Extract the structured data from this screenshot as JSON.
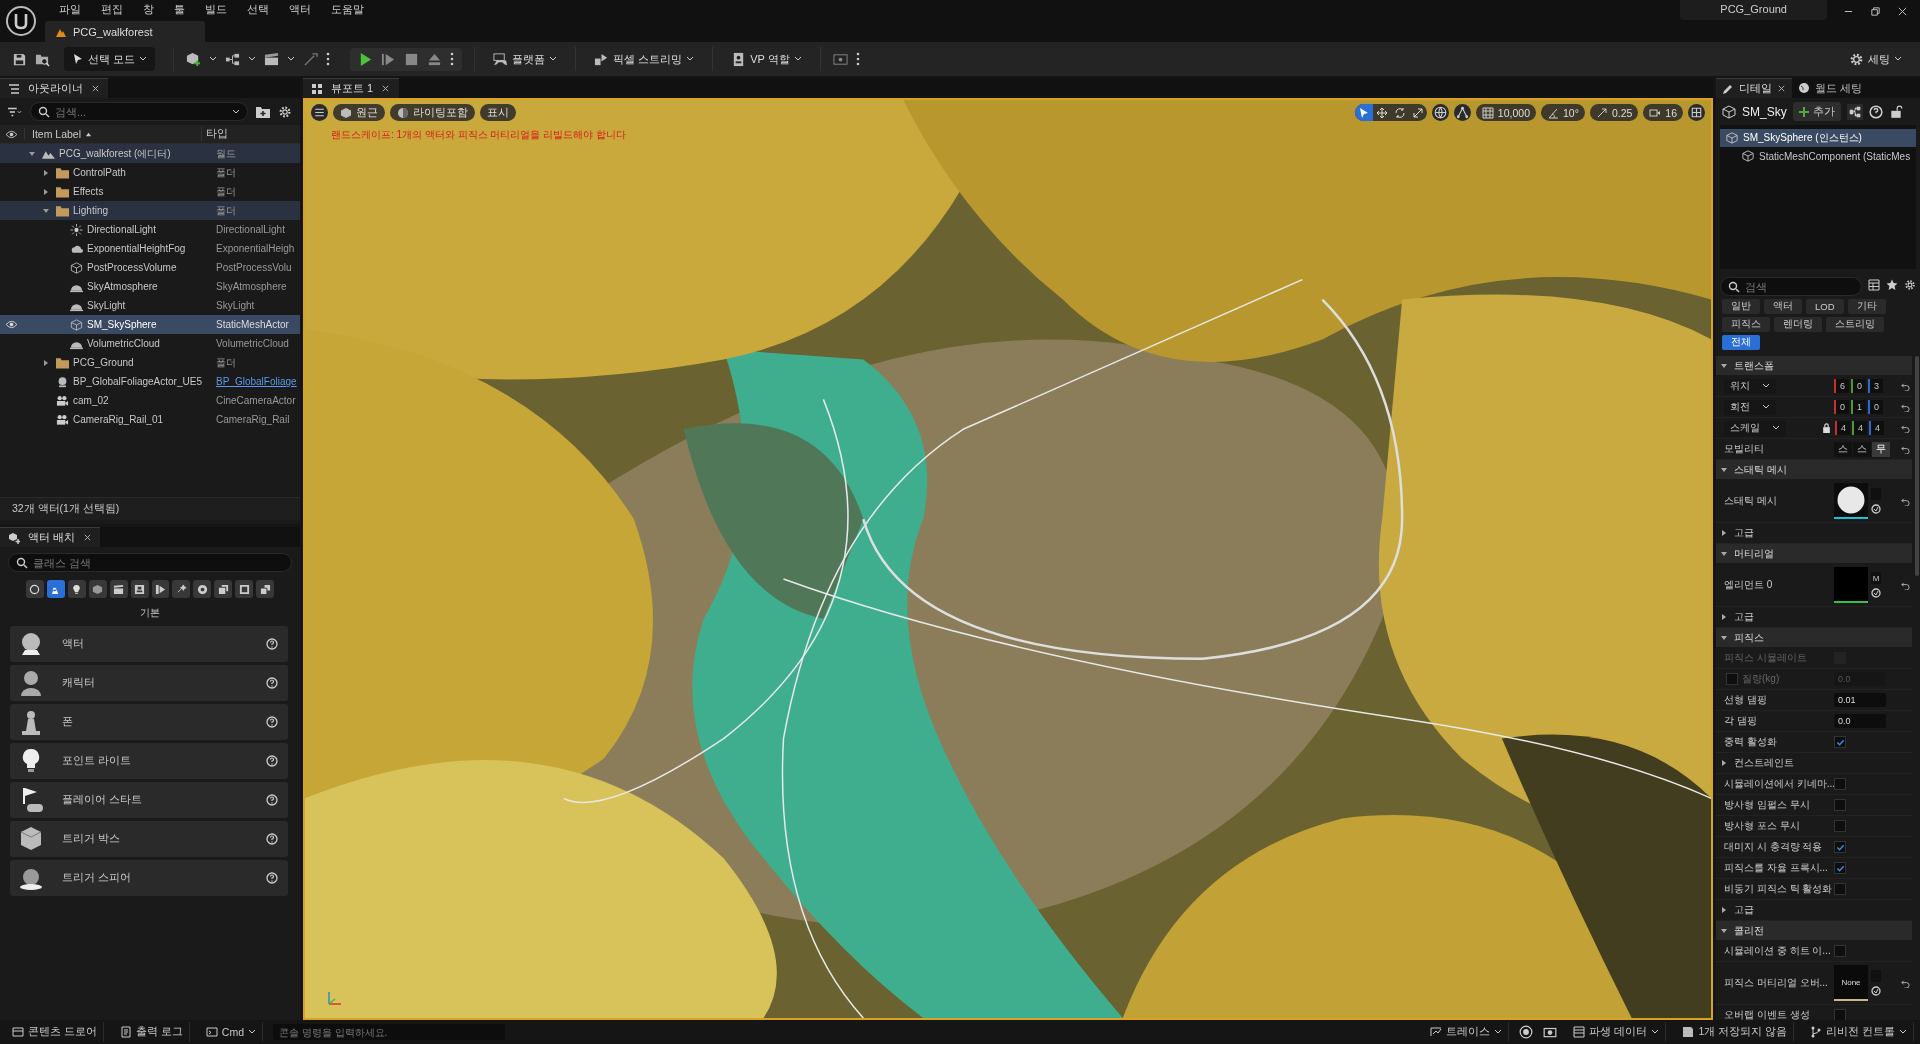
{
  "menu": [
    "파일",
    "편집",
    "창",
    "툴",
    "빌드",
    "선택",
    "액터",
    "도움말"
  ],
  "level_tab": "PCG_walkforest",
  "project": "PCG_Ground",
  "toolbar": {
    "mode": "선택 모드",
    "platform": "플랫폼",
    "pixel_streaming": "픽셀 스트리밍",
    "vp_role": "VP 역할",
    "settings": "세팅"
  },
  "outliner": {
    "tab": "아웃라이너",
    "search_placeholder": "검색...",
    "columns": [
      "Item Label",
      "타입"
    ],
    "tree": [
      {
        "label": "PCG_walkforest (에디터)",
        "type": "월드",
        "kind": "world",
        "selected": false,
        "linked": false,
        "expanded": true,
        "children": [
          {
            "label": "ControlPath",
            "type": "폴더",
            "kind": "folder",
            "selected": false,
            "linked": false,
            "expanded": false
          },
          {
            "label": "Effects",
            "type": "폴더",
            "kind": "folder",
            "selected": false,
            "linked": false,
            "expanded": false
          },
          {
            "label": "Lighting",
            "type": "폴더",
            "kind": "folder",
            "selected": false,
            "linked": false,
            "expanded": true,
            "children": [
              {
                "label": "DirectionalLight",
                "type": "DirectionalLight",
                "kind": "sun",
                "selected": false,
                "linked": false
              },
              {
                "label": "ExponentialHeightFog",
                "type": "ExponentialHeigh",
                "kind": "fog",
                "selected": false,
                "linked": false
              },
              {
                "label": "PostProcessVolume",
                "type": "PostProcessVolu",
                "kind": "volume",
                "selected": false,
                "linked": false
              },
              {
                "label": "SkyAtmosphere",
                "type": "SkyAtmosphere",
                "kind": "dome",
                "selected": false,
                "linked": false
              },
              {
                "label": "SkyLight",
                "type": "SkyLight",
                "kind": "dome",
                "selected": false,
                "linked": false
              },
              {
                "label": "SM_SkySphere",
                "type": "StaticMeshActor",
                "kind": "mesh",
                "selected": true,
                "linked": false
              },
              {
                "label": "VolumetricCloud",
                "type": "VolumetricCloud",
                "kind": "dome",
                "selected": false,
                "linked": false
              }
            ]
          },
          {
            "label": "PCG_Ground",
            "type": "폴더",
            "kind": "folder",
            "selected": false,
            "linked": false,
            "expanded": false
          },
          {
            "label": "BP_GlobalFoliageActor_UE5",
            "type": "BP_GlobalFoliage",
            "kind": "actor",
            "selected": false,
            "linked": true
          },
          {
            "label": "cam_02",
            "type": "CineCameraActor",
            "kind": "camera",
            "selected": false,
            "linked": false
          },
          {
            "label": "CameraRig_Rail_01",
            "type": "CameraRig_Rail",
            "kind": "rail",
            "selected": false,
            "linked": false
          }
        ]
      }
    ],
    "status": "32개 액터(1개 선택됨)"
  },
  "place_actors": {
    "tab": "액터 배치",
    "search_placeholder": "클래스 검색",
    "categories": [
      {
        "kind": "recent",
        "selected": false
      },
      {
        "kind": "basic",
        "selected": true
      },
      {
        "kind": "light",
        "selected": false
      },
      {
        "kind": "shape",
        "selected": false
      },
      {
        "kind": "cinematic",
        "selected": false
      },
      {
        "kind": "visual",
        "selected": false
      },
      {
        "kind": "volume",
        "selected": false
      },
      {
        "kind": "effects",
        "selected": false
      },
      {
        "kind": "classes",
        "selected": false
      },
      {
        "kind": "geometry",
        "selected": false
      },
      {
        "kind": "layout",
        "selected": false
      },
      {
        "kind": "extra",
        "selected": false
      }
    ],
    "heading": "기본",
    "items": [
      {
        "label": "액터",
        "kind": "actor"
      },
      {
        "label": "캐릭터",
        "kind": "character"
      },
      {
        "label": "폰",
        "kind": "pawn"
      },
      {
        "label": "포인트 라이트",
        "kind": "light"
      },
      {
        "label": "플레이어 스타트",
        "kind": "start"
      },
      {
        "label": "트리거 박스",
        "kind": "box"
      },
      {
        "label": "트리거 스피어",
        "kind": "sphere"
      }
    ]
  },
  "viewport": {
    "tab": "뷰포트 1",
    "view_buttons": [
      "원근",
      "라이팅포함",
      "표시"
    ],
    "warning": "랜드스케이프: 1개의 액터와 피직스 머티리얼을 리빌드해야 합니다",
    "tools": [
      {
        "kind": "select",
        "selected": true
      },
      {
        "kind": "move",
        "selected": false
      },
      {
        "kind": "rotate",
        "selected": false
      },
      {
        "kind": "scale",
        "selected": false
      }
    ],
    "grid_snap": "10,000",
    "rotation_snap": "10°",
    "scale_snap": "0.25",
    "camera_speed": "16"
  },
  "details": {
    "tabs": [
      {
        "label": "디테일",
        "selected": true
      },
      {
        "label": "월드 세팅",
        "selected": false
      }
    ],
    "actor_name": "SM_Sky",
    "add_button": "추가",
    "components": [
      {
        "label": "SM_SkySphere (인스턴스)",
        "selected": true
      },
      {
        "label": "StaticMeshComponent (StaticMes",
        "selected": false
      }
    ],
    "search_placeholder": "검색",
    "filters": [
      {
        "label": "일반",
        "selected": false
      },
      {
        "label": "액터",
        "selected": false
      },
      {
        "label": "LOD",
        "selected": false
      },
      {
        "label": "기타",
        "selected": false
      },
      {
        "label": "피직스",
        "selected": false
      },
      {
        "label": "렌더링",
        "selected": false
      },
      {
        "label": "스트리밍",
        "selected": false
      },
      {
        "label": "전체",
        "selected": true
      }
    ],
    "sections": [
      {
        "title": "트랜스폼",
        "expanded": true,
        "rows": [
          {
            "kind": "vector",
            "label": "위치",
            "values": [
              "6",
              "0",
              "3"
            ],
            "lock": false
          },
          {
            "kind": "vector",
            "label": "회전",
            "values": [
              "0",
              "1",
              "0"
            ],
            "lock": false
          },
          {
            "kind": "vector",
            "label": "스케일",
            "values": [
              "4",
              "4",
              "4"
            ],
            "lock": true
          },
          {
            "kind": "mobility",
            "label": "모빌리티",
            "options": [
              {
                "label": "스",
                "selected": false
              },
              {
                "label": "스",
                "selected": false
              },
              {
                "label": "무",
                "selected": true
              }
            ]
          }
        ]
      },
      {
        "title": "스태틱 메시",
        "expanded": true,
        "rows": [
          {
            "kind": "asset",
            "label": "스태틱 메시",
            "thumb": {
              "kind": "sphere"
            }
          },
          {
            "kind": "group",
            "label": "고급",
            "expanded": false
          }
        ]
      },
      {
        "title": "머티리얼",
        "expanded": true,
        "rows": [
          {
            "kind": "asset",
            "label": "엘리먼트 0",
            "thumb": {
              "kind": "material"
            },
            "tag": "M"
          },
          {
            "kind": "group",
            "label": "고급",
            "expanded": false
          }
        ]
      },
      {
        "title": "피직스",
        "expanded": true,
        "rows": [
          {
            "kind": "check",
            "label": "피직스 시뮬레이트",
            "checked": false,
            "disabled": true
          },
          {
            "kind": "override_number",
            "label": "질량(kg)",
            "checked": false,
            "value": "0.0",
            "disabled": true
          },
          {
            "kind": "number",
            "label": "선형 댐핑",
            "value": "0.01",
            "disabled": false
          },
          {
            "kind": "number",
            "label": "각 댐핑",
            "value": "0.0",
            "disabled": false
          },
          {
            "kind": "check",
            "label": "중력 활성화",
            "checked": true,
            "disabled": false
          },
          {
            "kind": "group",
            "label": "컨스트레인트",
            "expanded": false
          },
          {
            "kind": "check",
            "label": "시뮬레이션에서 키네마...",
            "checked": false,
            "disabled": false
          },
          {
            "kind": "check",
            "label": "방사형 임펄스 무시",
            "checked": false,
            "disabled": false
          },
          {
            "kind": "check",
            "label": "방사형 포스 무시",
            "checked": false,
            "disabled": false
          },
          {
            "kind": "check",
            "label": "대미지 시 충격량 적용",
            "checked": true,
            "disabled": false
          },
          {
            "kind": "check",
            "label": "피직스를 자율 프록시...",
            "checked": true,
            "disabled": false
          },
          {
            "kind": "check",
            "label": "비동기 피직스 틱 활성화",
            "checked": false,
            "disabled": false
          },
          {
            "kind": "group",
            "label": "고급",
            "expanded": false
          }
        ]
      },
      {
        "title": "콜리전",
        "expanded": true,
        "rows": [
          {
            "kind": "check",
            "label": "시뮬레이션 중 히트 이...",
            "checked": false,
            "disabled": false
          },
          {
            "kind": "asset",
            "label": "피직스 머티리얼 오버...",
            "thumb": {
              "kind": "none",
              "text": "None"
            }
          },
          {
            "kind": "check",
            "label": "오버랩 이벤트 생성",
            "checked": false,
            "disabled": false
          }
        ]
      }
    ]
  },
  "status_bar": {
    "content_drawer": "콘텐츠 드로어",
    "output_log": "출력 로그",
    "cmd": "Cmd",
    "console_placeholder": "콘솔 명령을 입력하세요.",
    "trace": "트레이스",
    "derived_data": "파생 데이터",
    "unsaved": "1개 저장되지 않음",
    "revision_control": "리비전 컨트롤"
  }
}
